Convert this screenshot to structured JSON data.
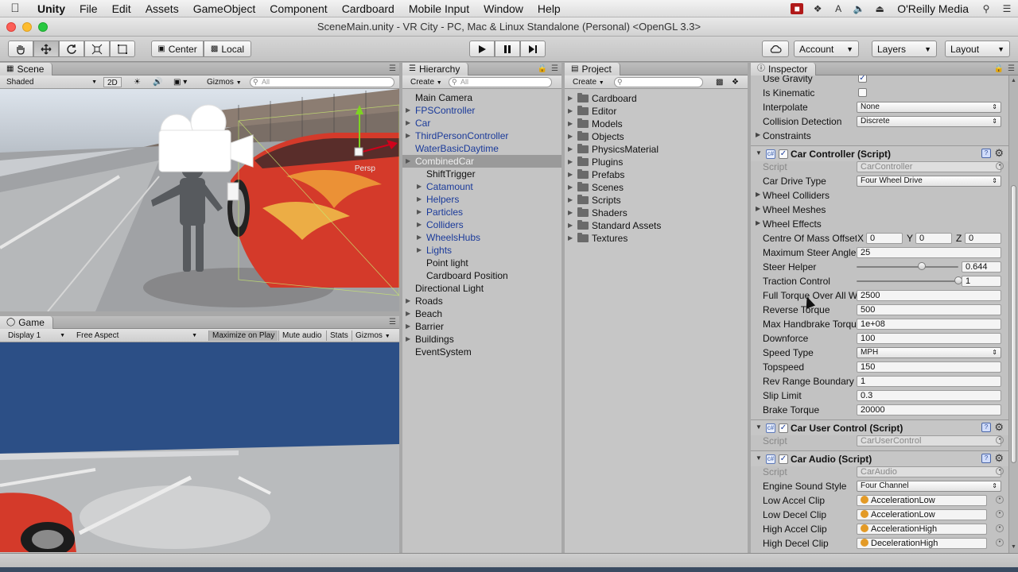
{
  "menubar": {
    "app": "Unity",
    "items": [
      "File",
      "Edit",
      "Assets",
      "GameObject",
      "Component",
      "Cardboard",
      "Mobile Input",
      "Window",
      "Help"
    ],
    "right_label": "O'Reilly Media"
  },
  "window": {
    "title": "SceneMain.unity - VR City - PC, Mac & Linux Standalone (Personal) <OpenGL 3.3>"
  },
  "toolbar": {
    "pivot": "Center",
    "space": "Local",
    "account": "Account",
    "layers": "Layers",
    "layout": "Layout"
  },
  "scene": {
    "tab": "Scene",
    "shading": "Shaded",
    "mode_2d": "2D",
    "gizmos": "Gizmos",
    "search_placeholder": "All",
    "persp_label": "Persp"
  },
  "game": {
    "tab": "Game",
    "display": "Display 1",
    "aspect": "Free Aspect",
    "maximize": "Maximize on Play",
    "mute": "Mute audio",
    "stats": "Stats",
    "gizmos": "Gizmos"
  },
  "hierarchy": {
    "tab": "Hierarchy",
    "create": "Create",
    "search_placeholder": "All",
    "items": [
      {
        "label": "Main Camera",
        "indent": 0,
        "arrow": false,
        "blue": false,
        "selected": false
      },
      {
        "label": "FPSController",
        "indent": 0,
        "arrow": true,
        "blue": true,
        "selected": false
      },
      {
        "label": "Car",
        "indent": 0,
        "arrow": true,
        "blue": true,
        "selected": false
      },
      {
        "label": "ThirdPersonController",
        "indent": 0,
        "arrow": true,
        "blue": true,
        "selected": false
      },
      {
        "label": "WaterBasicDaytime",
        "indent": 0,
        "arrow": false,
        "blue": true,
        "selected": false
      },
      {
        "label": "CombinedCar",
        "indent": 0,
        "arrow": true,
        "blue": false,
        "selected": true
      },
      {
        "label": "ShiftTrigger",
        "indent": 1,
        "arrow": false,
        "blue": false,
        "selected": false
      },
      {
        "label": "Catamount",
        "indent": 1,
        "arrow": true,
        "blue": true,
        "selected": false
      },
      {
        "label": "Helpers",
        "indent": 1,
        "arrow": true,
        "blue": true,
        "selected": false
      },
      {
        "label": "Particles",
        "indent": 1,
        "arrow": true,
        "blue": true,
        "selected": false
      },
      {
        "label": "Colliders",
        "indent": 1,
        "arrow": true,
        "blue": true,
        "selected": false
      },
      {
        "label": "WheelsHubs",
        "indent": 1,
        "arrow": true,
        "blue": true,
        "selected": false
      },
      {
        "label": "Lights",
        "indent": 1,
        "arrow": true,
        "blue": true,
        "selected": false
      },
      {
        "label": "Point light",
        "indent": 1,
        "arrow": false,
        "blue": false,
        "selected": false
      },
      {
        "label": "Cardboard Position",
        "indent": 1,
        "arrow": false,
        "blue": false,
        "selected": false
      },
      {
        "label": "Directional Light",
        "indent": 0,
        "arrow": false,
        "blue": false,
        "selected": false
      },
      {
        "label": "Roads",
        "indent": 0,
        "arrow": true,
        "blue": false,
        "selected": false
      },
      {
        "label": "Beach",
        "indent": 0,
        "arrow": true,
        "blue": false,
        "selected": false
      },
      {
        "label": "Barrier",
        "indent": 0,
        "arrow": true,
        "blue": false,
        "selected": false
      },
      {
        "label": "Buildings",
        "indent": 0,
        "arrow": true,
        "blue": false,
        "selected": false
      },
      {
        "label": "EventSystem",
        "indent": 0,
        "arrow": false,
        "blue": false,
        "selected": false
      }
    ]
  },
  "project": {
    "tab": "Project",
    "create": "Create",
    "folders": [
      "Cardboard",
      "Editor",
      "Models",
      "Objects",
      "PhysicsMaterial",
      "Plugins",
      "Prefabs",
      "Scenes",
      "Scripts",
      "Shaders",
      "Standard Assets",
      "Textures"
    ]
  },
  "inspector": {
    "tab": "Inspector",
    "rigidbody": {
      "use_gravity": "Use Gravity",
      "is_kinematic": "Is Kinematic",
      "interpolate": "Interpolate",
      "interpolate_value": "None",
      "collision_detection": "Collision Detection",
      "collision_value": "Discrete",
      "constraints": "Constraints"
    },
    "car_controller": {
      "title": "Car Controller (Script)",
      "script_label": "Script",
      "script_value": "CarController",
      "drive_type_label": "Car Drive Type",
      "drive_type_value": "Four Wheel Drive",
      "wheel_colliders": "Wheel Colliders",
      "wheel_meshes": "Wheel Meshes",
      "wheel_effects": "Wheel Effects",
      "com_label": "Centre Of Mass Offset",
      "com_x": "0",
      "com_y": "0",
      "com_z": "0",
      "x_label": "X",
      "y_label": "Y",
      "z_label": "Z",
      "max_steer_label": "Maximum Steer Angle",
      "max_steer_value": "25",
      "steer_helper_label": "Steer Helper",
      "steer_helper_value": "0.644",
      "traction_label": "Traction Control",
      "traction_value": "1",
      "full_torque_label": "Full Torque Over All W",
      "full_torque_value": "2500",
      "reverse_torque_label": "Reverse Torque",
      "reverse_torque_value": "500",
      "handbrake_label": "Max Handbrake Torque",
      "handbrake_value": "1e+08",
      "downforce_label": "Downforce",
      "downforce_value": "100",
      "speed_type_label": "Speed Type",
      "speed_type_value": "MPH",
      "topspeed_label": "Topspeed",
      "topspeed_value": "150",
      "rev_range_label": "Rev Range Boundary",
      "rev_range_value": "1",
      "slip_label": "Slip Limit",
      "slip_value": "0.3",
      "brake_label": "Brake Torque",
      "brake_value": "20000"
    },
    "car_user_control": {
      "title": "Car User Control (Script)",
      "script_label": "Script",
      "script_value": "CarUserControl"
    },
    "car_audio": {
      "title": "Car Audio (Script)",
      "script_label": "Script",
      "script_value": "CarAudio",
      "engine_label": "Engine Sound Style",
      "engine_value": "Four Channel",
      "low_accel_label": "Low Accel Clip",
      "low_accel_value": "AccelerationLow",
      "low_decel_label": "Low Decel Clip",
      "low_decel_value": "AccelerationLow",
      "high_accel_label": "High Accel Clip",
      "high_accel_value": "AccelerationHigh",
      "high_decel_label": "High Decel Clip",
      "high_decel_value": "DecelerationHigh"
    }
  },
  "sliders": {
    "steer_helper": 0.644,
    "traction_control": 1
  },
  "colors": {
    "accent_blue": "#1a3a9a",
    "selection": "#9a9a9a",
    "car_red": "#d43a2a",
    "sky_blue": "#2c4f86"
  }
}
